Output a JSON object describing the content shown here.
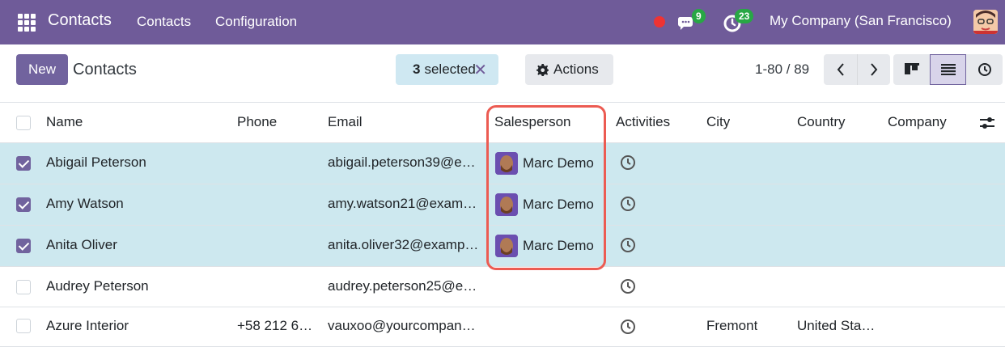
{
  "navbar": {
    "brand": "Contacts",
    "menu": [
      "Contacts",
      "Configuration"
    ],
    "messages_count": "9",
    "activities_count": "23",
    "company": "My Company (San Francisco)"
  },
  "control": {
    "new_label": "New",
    "title": "Contacts",
    "selected_count": "3",
    "selected_label": "selected",
    "actions_label": "Actions",
    "pager": "1-80 / 89"
  },
  "columns": [
    "Name",
    "Phone",
    "Email",
    "Salesperson",
    "Activities",
    "City",
    "Country",
    "Company"
  ],
  "rows": [
    {
      "name": "Abigail Peterson",
      "phone": "",
      "email": "abigail.peterson39@e…",
      "salesperson": "Marc Demo",
      "city": "",
      "country": "",
      "company": ""
    },
    {
      "name": "Amy Watson",
      "phone": "",
      "email": "amy.watson21@exam…",
      "salesperson": "Marc Demo",
      "city": "",
      "country": "",
      "company": ""
    },
    {
      "name": "Anita Oliver",
      "phone": "",
      "email": "anita.oliver32@examp…",
      "salesperson": "Marc Demo",
      "city": "",
      "country": "",
      "company": ""
    },
    {
      "name": "Audrey Peterson",
      "phone": "",
      "email": "audrey.peterson25@e…",
      "salesperson": "",
      "city": "",
      "country": "",
      "company": ""
    },
    {
      "name": "Azure Interior",
      "phone": "+58 212 6…",
      "email": "vauxoo@yourcompan…",
      "salesperson": "",
      "city": "Fremont",
      "country": "United Sta…",
      "company": ""
    }
  ],
  "colors": {
    "navbar": "#6f5b99",
    "primary": "#71639e",
    "selected_row": "#cde8ef",
    "highlight": "#ec5b52"
  },
  "icons": [
    "apps-grid-icon",
    "chat-icon",
    "activity-clock-icon",
    "gear-icon",
    "chevron-left-icon",
    "chevron-right-icon",
    "kanban-view-icon",
    "list-view-icon",
    "activity-view-icon",
    "clock-icon",
    "settings-sliders-icon"
  ]
}
